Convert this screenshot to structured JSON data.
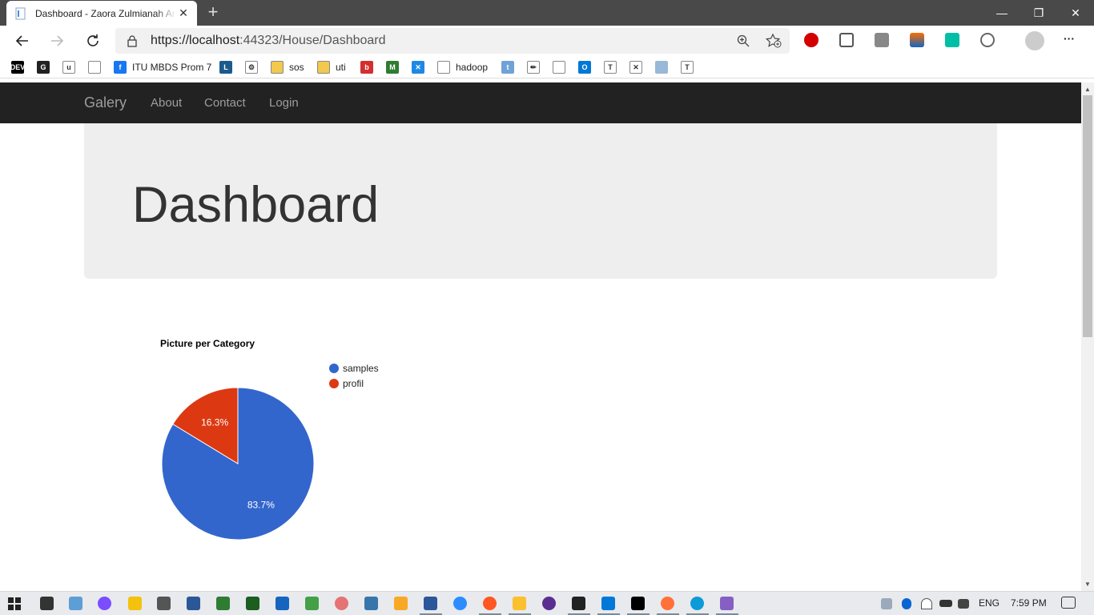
{
  "browser": {
    "tab_title": "Dashboard - Zaora Zulmianah Ar",
    "url_prefix": "https://localhost",
    "url_port_path": ":44323/House/Dashboard",
    "newtab_glyph": "+",
    "close_glyph": "✕",
    "win_min": "—",
    "win_restore": "❐",
    "win_close": "✕",
    "more_glyph": "···"
  },
  "bookmarks": [
    {
      "label": "",
      "icon": "dev-icon",
      "text": "DEV",
      "color": "#000"
    },
    {
      "label": "",
      "icon": "g-icon",
      "text": "G",
      "color": "#222"
    },
    {
      "label": "",
      "icon": "u-icon",
      "text": "u",
      "color": "#fff"
    },
    {
      "label": "",
      "icon": "page-icon",
      "text": "",
      "color": "#fff"
    },
    {
      "label": "ITU MBDS Prom 7",
      "icon": "facebook-icon",
      "text": "f",
      "color": "#1877f2"
    },
    {
      "label": "",
      "icon": "l-icon",
      "text": "L",
      "color": "#1d5a8c"
    },
    {
      "label": "",
      "icon": "gear-icon",
      "text": "⚙",
      "color": "#fff"
    },
    {
      "label": "sos",
      "icon": "folder-icon",
      "text": "",
      "color": "#f2c94c"
    },
    {
      "label": "uti",
      "icon": "folder-icon",
      "text": "",
      "color": "#f2c94c"
    },
    {
      "label": "",
      "icon": "b-icon",
      "text": "b",
      "color": "#d32f2f"
    },
    {
      "label": "",
      "icon": "m-icon",
      "text": "M",
      "color": "#2e7d32"
    },
    {
      "label": "",
      "icon": "x-icon",
      "text": "✕",
      "color": "#1e88e5"
    },
    {
      "label": "hadoop",
      "icon": "page-icon",
      "text": "",
      "color": "#fff"
    },
    {
      "label": "",
      "icon": "t-icon",
      "text": "t",
      "color": "#6fa3d6"
    },
    {
      "label": "",
      "icon": "pencil-icon",
      "text": "✏",
      "color": "#fff"
    },
    {
      "label": "",
      "icon": "page-icon",
      "text": "",
      "color": "#fff"
    },
    {
      "label": "",
      "icon": "outlook-icon",
      "text": "O",
      "color": "#0078d4"
    },
    {
      "label": "",
      "icon": "t-icon",
      "text": "T",
      "color": "#fff"
    },
    {
      "label": "",
      "icon": "cross-icon",
      "text": "✕",
      "color": "#fff"
    },
    {
      "label": "",
      "icon": "doc-icon",
      "text": "",
      "color": "#9ab8d8"
    },
    {
      "label": "",
      "icon": "t-icon",
      "text": "T",
      "color": "#fff"
    }
  ],
  "navbar": {
    "brand": "Galery",
    "links": [
      "About",
      "Contact",
      "Login"
    ]
  },
  "jumbotron": {
    "title": "Dashboard"
  },
  "chart_data": {
    "type": "pie",
    "title": "Picture per Category",
    "legend_position": "right",
    "slices": [
      {
        "label": "samples",
        "value": 83.7,
        "display": "83.7%",
        "color": "#3366cc"
      },
      {
        "label": "profil",
        "value": 16.3,
        "display": "16.3%",
        "color": "#dc3912"
      }
    ]
  },
  "taskbar": {
    "language": "ENG",
    "time": "7:59 PM"
  }
}
